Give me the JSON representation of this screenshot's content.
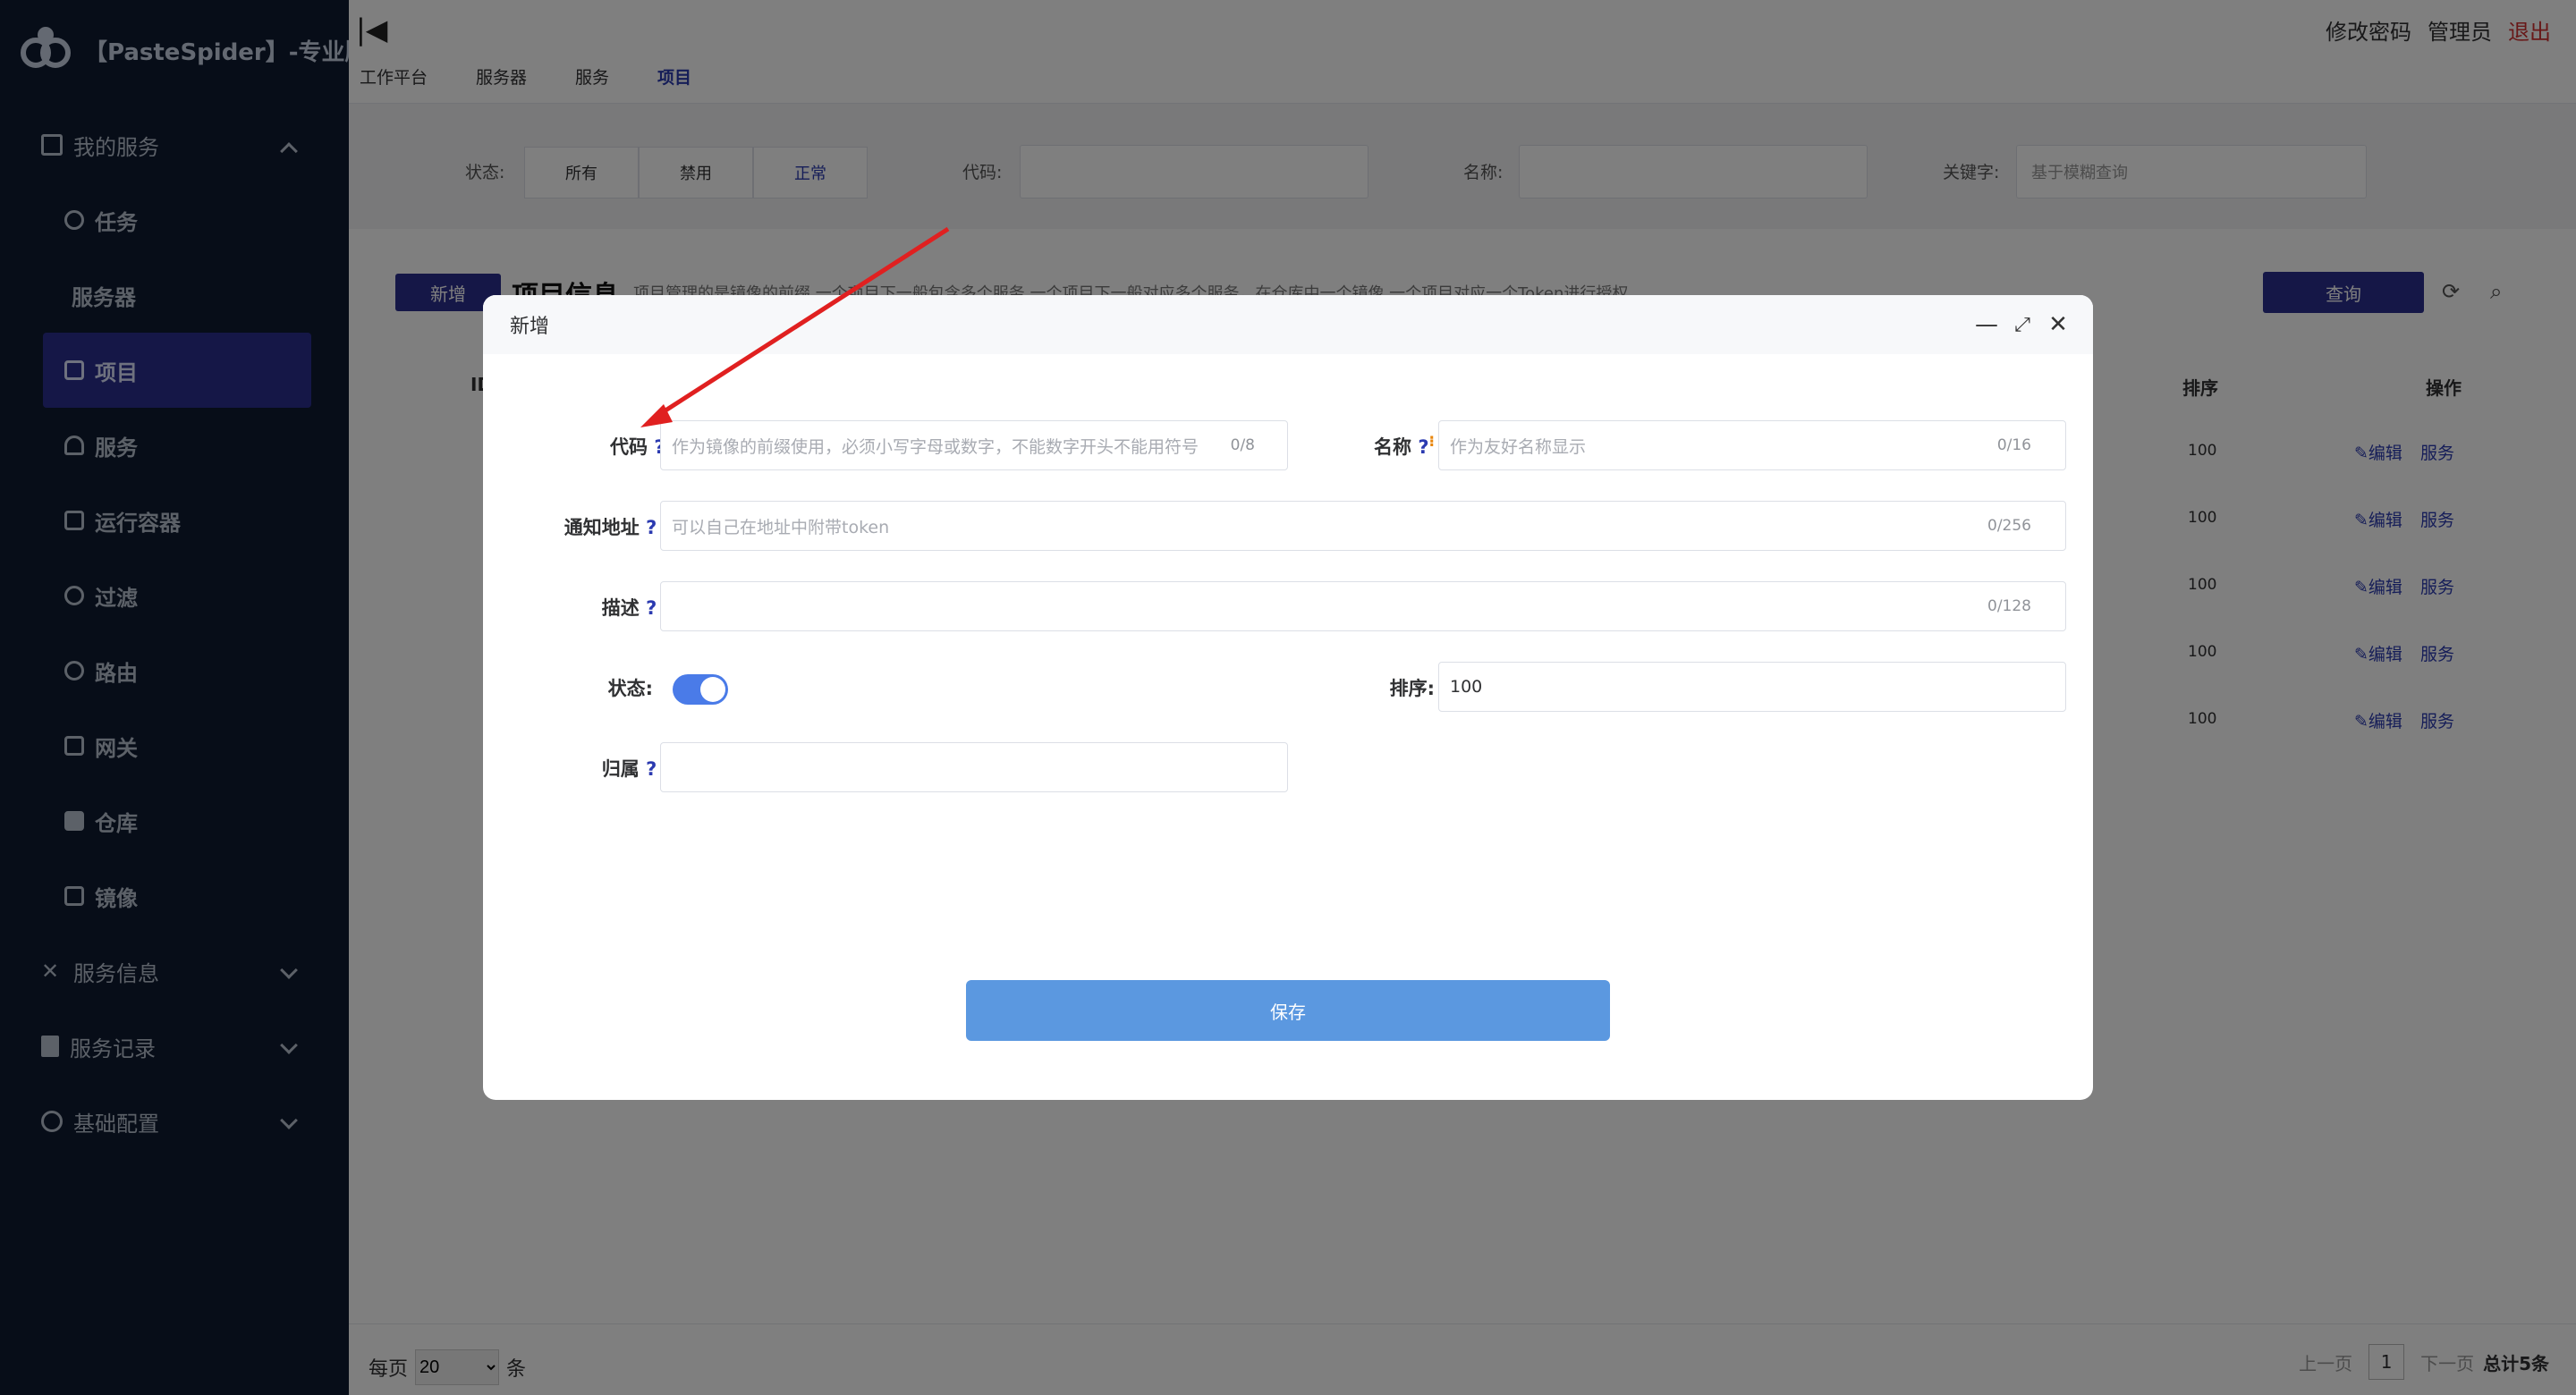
{
  "app": {
    "title": "【PasteSpider】-专业版"
  },
  "sidebar": {
    "groups": [
      {
        "label": "我的服务",
        "expanded": true
      },
      {
        "label": "服务信息",
        "expanded": false
      },
      {
        "label": "服务记录",
        "expanded": false
      },
      {
        "label": "基础配置",
        "expanded": false
      }
    ],
    "items": [
      {
        "label": "任务"
      },
      {
        "label": "服务器"
      },
      {
        "label": "项目",
        "active": true
      },
      {
        "label": "服务"
      },
      {
        "label": "运行容器"
      },
      {
        "label": "过滤"
      },
      {
        "label": "路由"
      },
      {
        "label": "网关"
      },
      {
        "label": "仓库"
      },
      {
        "label": "镜像"
      }
    ]
  },
  "topbar": {
    "tabs": [
      "工作平台",
      "服务器",
      "服务",
      "项目"
    ],
    "active_tab": "项目",
    "change_password": "修改密码",
    "user": "管理员",
    "logout": "退出"
  },
  "filters": {
    "status_label": "状态:",
    "status_options": [
      "所有",
      "禁用",
      "正常"
    ],
    "status_selected": "正常",
    "code_label": "代码:",
    "name_label": "名称:",
    "keyword_label": "关键字:",
    "keyword_placeholder": "基于模糊查询"
  },
  "table": {
    "new_button": "新增",
    "title": "项目信息",
    "description": "项目管理的是镜像的前缀 一个项目下一般包含多个服务 一个项目下一般对应多个服务，在仓库中一个镜像 一个项目对应一个Token进行授权",
    "query_button": "查询",
    "headers": {
      "id": "ID",
      "sort": "排序",
      "ops": "操作"
    },
    "rows": [
      {
        "sort": "100",
        "edit": "✎编辑",
        "service": "服务"
      },
      {
        "sort": "100",
        "edit": "✎编辑",
        "service": "服务"
      },
      {
        "sort": "100",
        "edit": "✎编辑",
        "service": "服务"
      },
      {
        "sort": "100",
        "edit": "✎编辑",
        "service": "服务"
      },
      {
        "sort": "100",
        "edit": "✎编辑",
        "service": "服务"
      }
    ]
  },
  "pager": {
    "per_page_label": "每页",
    "per_page_value": "20",
    "per_page_unit": "条",
    "prev": "上一页",
    "current_page": "1",
    "next": "下一页",
    "total": "总计5条"
  },
  "modal": {
    "title": "新增",
    "code": {
      "label": "代码",
      "placeholder": "作为镜像的前缀使用，必须小写字母或数字，不能数字开头不能用符号",
      "counter": "0/8"
    },
    "name": {
      "label": "名称",
      "placeholder": "作为友好名称显示",
      "counter": "0/16"
    },
    "notify": {
      "label": "通知地址",
      "placeholder": "可以自己在地址中附带token",
      "counter": "0/256"
    },
    "desc": {
      "label": "描述",
      "placeholder": "",
      "counter": "0/128"
    },
    "status": {
      "label": "状态:",
      "enabled": true
    },
    "sort": {
      "label": "排序:",
      "value": "100"
    },
    "owner": {
      "label": "归属"
    },
    "save_button": "保存"
  },
  "colors": {
    "sidebar_bg": "#0f1a30",
    "primary": "#2b2f8f",
    "accent_blue": "#4a7be8",
    "save_blue": "#5b98e0",
    "annotation_arrow": "#e02020"
  }
}
